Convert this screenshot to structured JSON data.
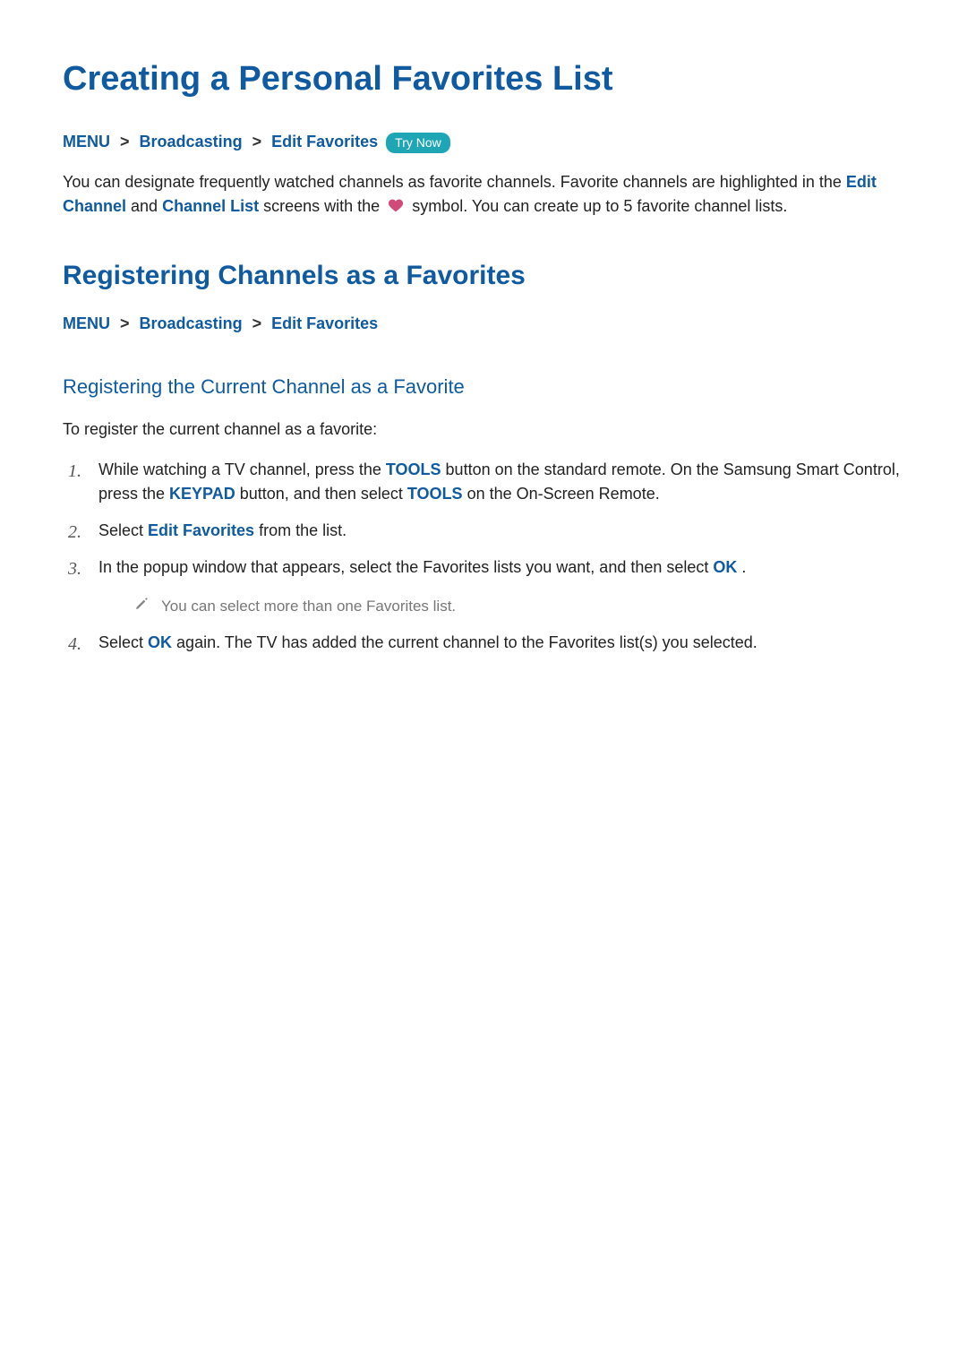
{
  "page_title": "Creating a Personal Favorites List",
  "breadcrumb1": {
    "menu": "MENU",
    "broadcasting": "Broadcasting",
    "editFavorites": "Edit Favorites",
    "tryNow": "Try Now"
  },
  "sep": ">",
  "intro": {
    "p1a": "You can designate frequently watched channels as favorite channels. Favorite channels are highlighted in the ",
    "editChannel": "Edit Channel",
    "and": " and ",
    "channelList": "Channel List",
    "p1b": " screens with the ",
    "p1c": " symbol. You can create up to 5 favorite channel lists."
  },
  "section_title": "Registering Channels as a Favorites",
  "breadcrumb2": {
    "menu": "MENU",
    "broadcasting": "Broadcasting",
    "editFavorites": "Edit Favorites"
  },
  "subsection_title": "Registering the Current Channel as a Favorite",
  "lead": "To register the current channel as a favorite:",
  "steps": {
    "s1a": "While watching a TV channel, press the ",
    "s1_tools": "TOOLS",
    "s1b": " button on the standard remote. On the Samsung Smart Control, press the ",
    "s1_keypad": "KEYPAD",
    "s1c": " button, and then select ",
    "s1_tools2": "TOOLS",
    "s1d": " on the On-Screen Remote.",
    "s2a": "Select ",
    "s2_ef": "Edit Favorites",
    "s2b": " from the list.",
    "s3a": "In the popup window that appears, select the Favorites lists you want, and then select ",
    "s3_ok": "OK",
    "s3b": ".",
    "note": "You can select more than one Favorites list.",
    "s4a": "Select ",
    "s4_ok": "OK",
    "s4b": " again. The TV has added the current channel to the Favorites list(s) you selected."
  }
}
